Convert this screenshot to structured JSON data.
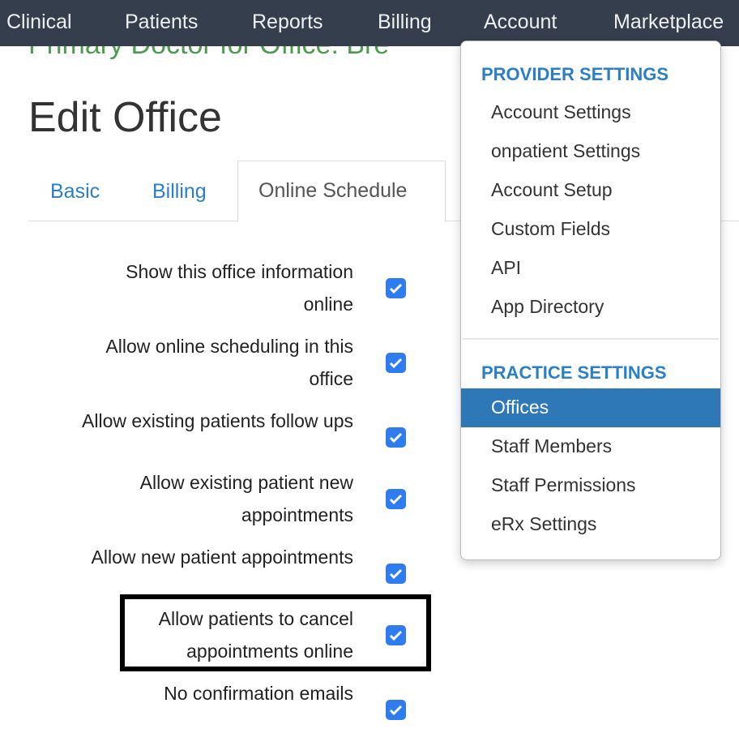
{
  "nav": [
    "Clinical",
    "Patients",
    "Reports",
    "Billing",
    "Account",
    "Marketplace"
  ],
  "subtitle": "Primary Doctor for Office: Bre",
  "page_title": "Edit Office",
  "tabs": [
    "Basic",
    "Billing",
    "Online Schedule"
  ],
  "active_tab": "Online Schedule",
  "settings": [
    {
      "label": "Show this office information online",
      "checked": true
    },
    {
      "label": "Allow online scheduling in this office",
      "checked": true
    },
    {
      "label": "Allow existing patients follow ups",
      "checked": true
    },
    {
      "label": "Allow existing patient new appointments",
      "checked": true
    },
    {
      "label": "Allow new patient appointments",
      "checked": true
    },
    {
      "label": "Allow patients to cancel appointments online",
      "checked": true
    },
    {
      "label": "No confirmation emails",
      "checked": true
    }
  ],
  "menu": {
    "provider_header": "PROVIDER SETTINGS",
    "provider_items": [
      "Account Settings",
      "onpatient Settings",
      "Account Setup",
      "Custom Fields",
      "API",
      "App Directory"
    ],
    "practice_header": "PRACTICE SETTINGS",
    "practice_items": [
      "Offices",
      "Staff Members",
      "Staff Permissions",
      "eRx Settings"
    ],
    "active_item": "Offices"
  },
  "colors": {
    "navbar": "#343e4c",
    "link": "#2a7fc7",
    "checkbox": "#2f7bf0",
    "active": "#2f78b8"
  }
}
